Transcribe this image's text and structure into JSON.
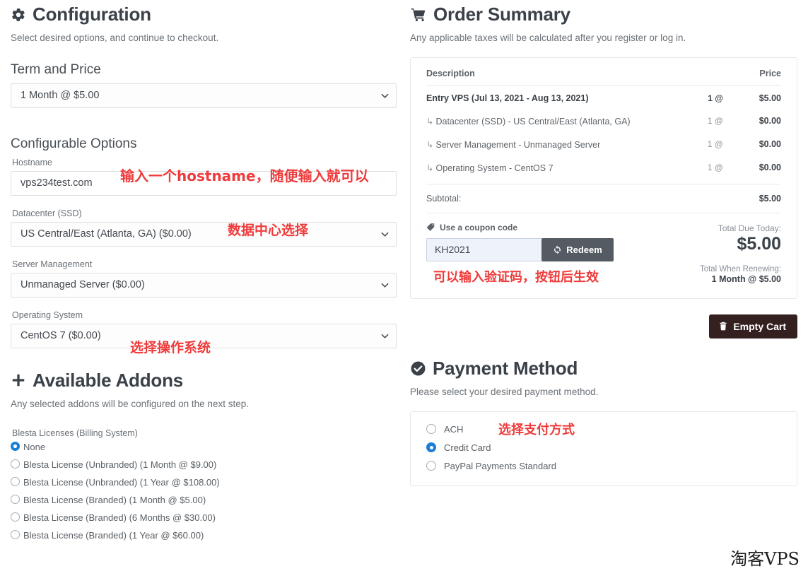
{
  "configuration": {
    "icon": "gear-icon",
    "title": "Configuration",
    "subtitle": "Select desired options, and continue to checkout.",
    "term_section_title": "Term and Price",
    "term_value": "1 Month @ $5.00",
    "options_section_title": "Configurable Options",
    "hostname_label": "Hostname",
    "hostname_value": "vps234test.com",
    "datacenter_label": "Datacenter (SSD)",
    "datacenter_value": "US Central/East (Atlanta, GA) ($0.00)",
    "management_label": "Server Management",
    "management_value": "Unmanaged Server ($0.00)",
    "os_label": "Operating System",
    "os_value": "CentOS 7 ($0.00)"
  },
  "addons": {
    "icon": "plus-icon",
    "title": "Available Addons",
    "subtitle": "Any selected addons will be configured on the next step.",
    "group_label": "Blesta Licenses (Billing System)",
    "options": [
      {
        "label": "None",
        "selected": true
      },
      {
        "label": "Blesta License (Unbranded) (1 Month @ $9.00)",
        "selected": false
      },
      {
        "label": "Blesta License (Unbranded) (1 Year @ $108.00)",
        "selected": false
      },
      {
        "label": "Blesta License (Branded) (1 Month @ $5.00)",
        "selected": false
      },
      {
        "label": "Blesta License (Branded) (6 Months @ $30.00)",
        "selected": false
      },
      {
        "label": "Blesta License (Branded) (1 Year @ $60.00)",
        "selected": false
      }
    ]
  },
  "order_summary": {
    "icon": "cart-icon",
    "title": "Order Summary",
    "subtitle": "Any applicable taxes will be calculated after you register or log in.",
    "columns": {
      "description": "Description",
      "price": "Price"
    },
    "rows": [
      {
        "description": "Entry VPS (Jul 13, 2021 - Aug 13, 2021)",
        "qty": "1 @",
        "price": "$5.00",
        "main": true
      },
      {
        "description": "Datacenter (SSD) - US Central/East (Atlanta, GA)",
        "qty": "1 @",
        "price": "$0.00",
        "main": false
      },
      {
        "description": "Server Management - Unmanaged Server",
        "qty": "1 @",
        "price": "$0.00",
        "main": false
      },
      {
        "description": "Operating System - CentOS 7",
        "qty": "1 @",
        "price": "$0.00",
        "main": false
      }
    ],
    "subtotal_label": "Subtotal:",
    "subtotal_value": "$5.00",
    "coupon_title": "Use a coupon code",
    "coupon_value": "KH2021",
    "redeem_label": "Redeem",
    "total_due_label": "Total Due Today:",
    "total_due_value": "$5.00",
    "renew_label": "Total When Renewing:",
    "renew_value": "1 Month @ $5.00",
    "empty_cart_label": "Empty Cart"
  },
  "payment_method": {
    "icon": "check-circle-icon",
    "title": "Payment Method",
    "subtitle": "Please select your desired payment method.",
    "options": [
      {
        "label": "ACH",
        "selected": false
      },
      {
        "label": "Credit Card",
        "selected": true
      },
      {
        "label": "PayPal Payments Standard",
        "selected": false
      }
    ]
  },
  "annotations": {
    "hostname": "输入一个hostname，随便输入就可以",
    "datacenter": "数据中心选择",
    "os": "选择操作系统",
    "coupon": "可以输入验证码，按钮后生效",
    "payment": "选择支付方式"
  },
  "watermark": "淘客VPS",
  "colors": {
    "accent_radio": "#1a7fd4",
    "annotation_red": "#ef3b3b",
    "empty_cart_bg": "#33201f",
    "redeem_bg": "#545b62"
  }
}
